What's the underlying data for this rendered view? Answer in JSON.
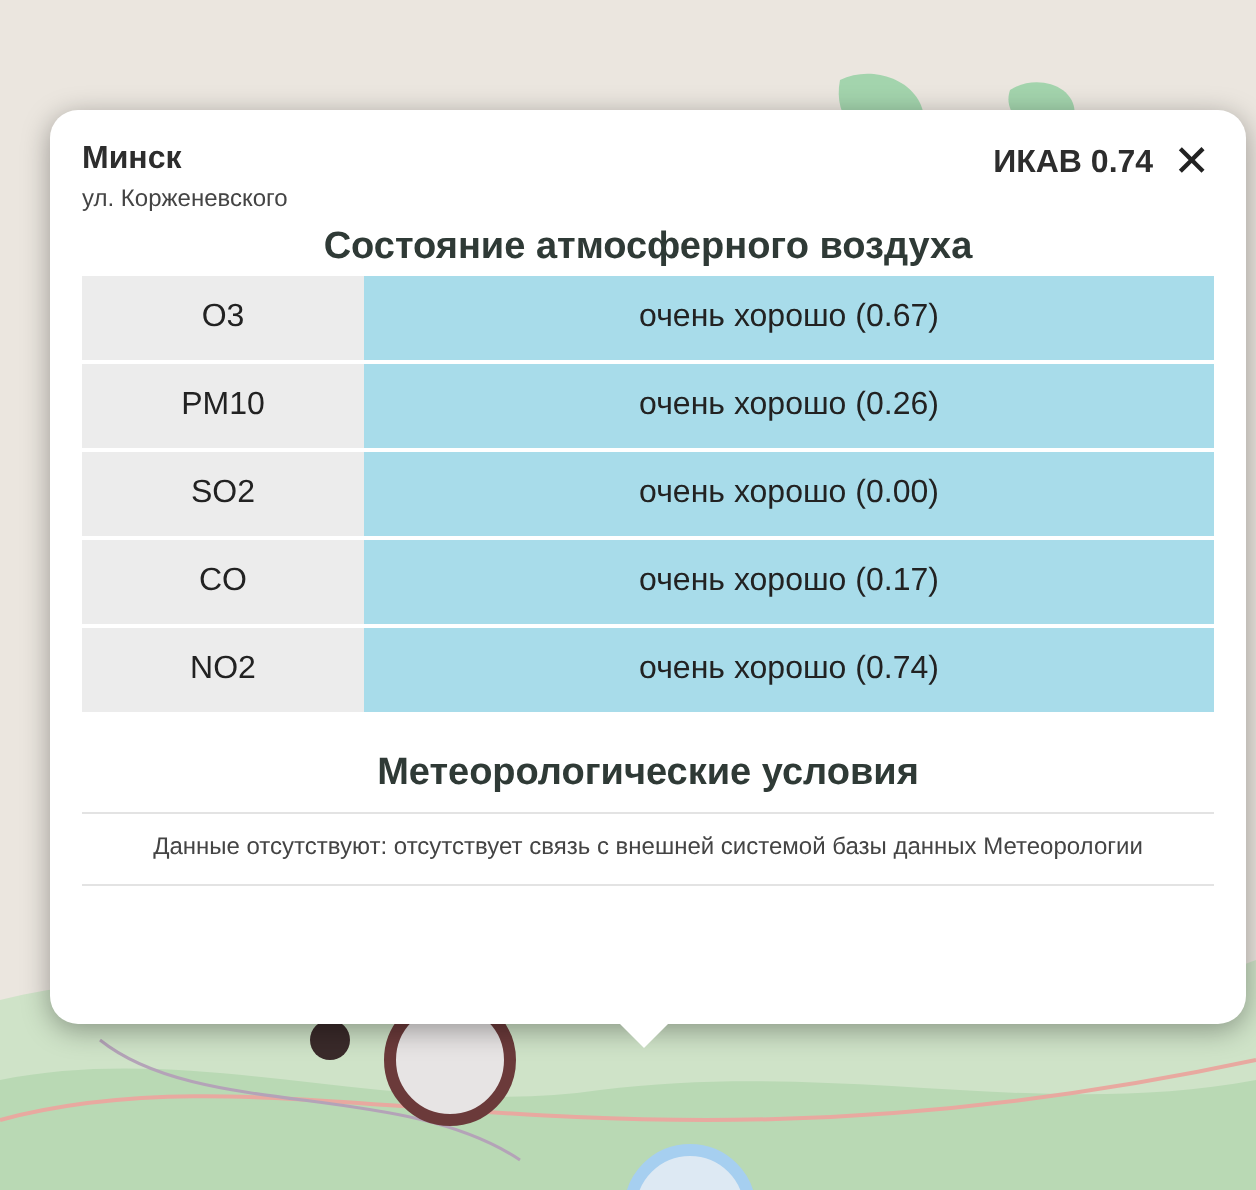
{
  "popup": {
    "city": "Минск",
    "street": "ул. Корженевского",
    "index": "ИКАВ 0.74",
    "close": "✕",
    "air_title": "Состояние атмосферного воздуха",
    "air_rows": [
      {
        "pollutant": "O3",
        "status": "очень хорошо (0.67)",
        "color": "#a8dcea"
      },
      {
        "pollutant": "PM10",
        "status": "очень хорошо (0.26)",
        "color": "#a8dcea"
      },
      {
        "pollutant": "SO2",
        "status": "очень хорошо (0.00)",
        "color": "#a8dcea"
      },
      {
        "pollutant": "CO",
        "status": "очень хорошо (0.17)",
        "color": "#a8dcea"
      },
      {
        "pollutant": "NO2",
        "status": "очень хорошо (0.74)",
        "color": "#a8dcea"
      }
    ],
    "meteo_title": "Метеорологические условия",
    "meteo_message": "Данные отсутствуют: отсутствует связь с внешней системой базы данных Метеорологии"
  }
}
